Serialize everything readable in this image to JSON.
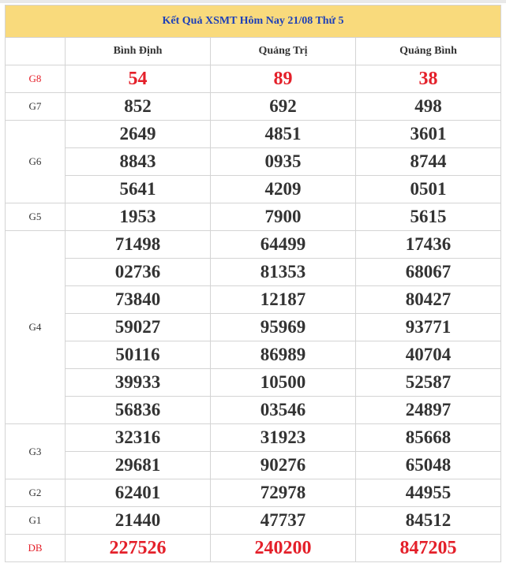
{
  "title": "Kết Quả XSMT Hôm Nay 21/08 Thứ 5",
  "provinces": [
    "Bình Định",
    "Quảng Trị",
    "Quảng Bình"
  ],
  "colors": {
    "header_bg": "#f9da7c",
    "title_text": "#1c3fb8",
    "highlight_red": "#e4202a",
    "border": "#d4d4d4"
  },
  "prizes": [
    {
      "label": "G8",
      "highlight": true,
      "rows": [
        [
          "54",
          "89",
          "38"
        ]
      ]
    },
    {
      "label": "G7",
      "highlight": false,
      "rows": [
        [
          "852",
          "692",
          "498"
        ]
      ]
    },
    {
      "label": "G6",
      "highlight": false,
      "rows": [
        [
          "2649",
          "4851",
          "3601"
        ],
        [
          "8843",
          "0935",
          "8744"
        ],
        [
          "5641",
          "4209",
          "0501"
        ]
      ]
    },
    {
      "label": "G5",
      "highlight": false,
      "rows": [
        [
          "1953",
          "7900",
          "5615"
        ]
      ]
    },
    {
      "label": "G4",
      "highlight": false,
      "rows": [
        [
          "71498",
          "64499",
          "17436"
        ],
        [
          "02736",
          "81353",
          "68067"
        ],
        [
          "73840",
          "12187",
          "80427"
        ],
        [
          "59027",
          "95969",
          "93771"
        ],
        [
          "50116",
          "86989",
          "40704"
        ],
        [
          "39933",
          "10500",
          "52587"
        ],
        [
          "56836",
          "03546",
          "24897"
        ]
      ]
    },
    {
      "label": "G3",
      "highlight": false,
      "rows": [
        [
          "32316",
          "31923",
          "85668"
        ],
        [
          "29681",
          "90276",
          "65048"
        ]
      ]
    },
    {
      "label": "G2",
      "highlight": false,
      "rows": [
        [
          "62401",
          "72978",
          "44955"
        ]
      ]
    },
    {
      "label": "G1",
      "highlight": false,
      "rows": [
        [
          "21440",
          "47737",
          "84512"
        ]
      ]
    },
    {
      "label": "DB",
      "highlight": true,
      "rows": [
        [
          "227526",
          "240200",
          "847205"
        ]
      ]
    }
  ]
}
